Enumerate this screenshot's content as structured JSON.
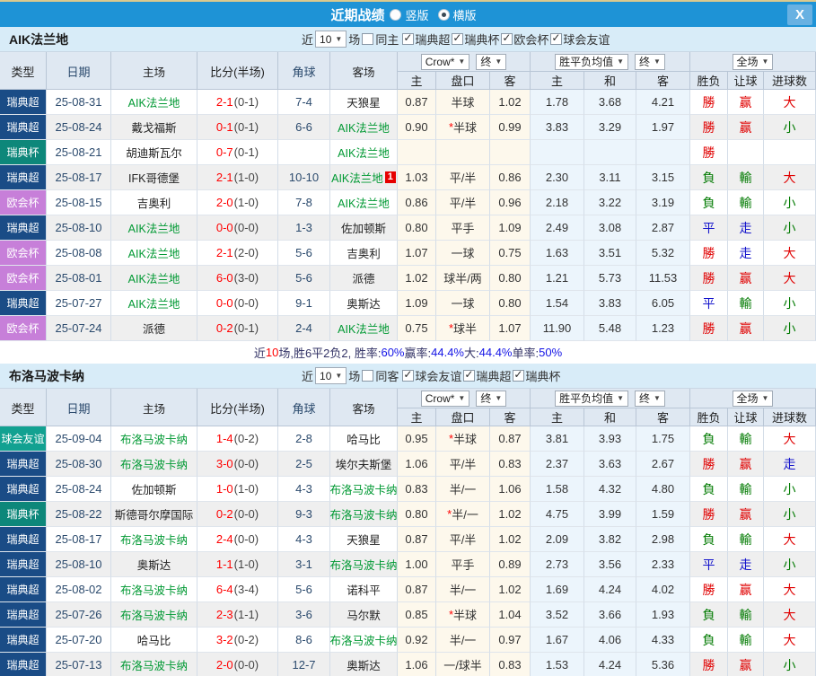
{
  "titlebar": {
    "title": "近期战绩",
    "radio_options": [
      {
        "label": "竖版",
        "selected": false
      },
      {
        "label": "横版",
        "selected": true
      }
    ],
    "close_label": "X"
  },
  "colors": {
    "topbar": "#1e93d6",
    "topbar_trim": "#dbc98e",
    "section_bg": "#d8ecf8",
    "header_bg": "#dfe8f2",
    "highlight_team": "#009933",
    "score_red": "#ff0000",
    "odds_cell_bg": "#fdf8ec",
    "avg_cell_bg": "#ecf5fc",
    "zebra_row_bg": "#efefef"
  },
  "league_colors": {
    "瑞典超": "#1a4c86",
    "瑞典杯": "#0d877a",
    "欧会杯": "#c77fd9",
    "球会友谊": "#12a191"
  },
  "result_colors": {
    "勝": "#e00000",
    "負": "#007a00",
    "平": "#1515cc",
    "赢": "#e00000",
    "輸": "#007a00",
    "走": "#1515cc",
    "大": "#e00000",
    "小": "#007a00"
  },
  "table_header": {
    "cols": [
      "类型",
      "日期",
      "主场",
      "比分(半场)",
      "角球",
      "客场"
    ],
    "odds_select": "Crow*",
    "odds_final_select": "终",
    "odds_subcols": [
      "主",
      "盘口",
      "客"
    ],
    "avg_select": "胜平负均值",
    "avg_final_select": "终",
    "avg_subcols": [
      "主",
      "和",
      "客"
    ],
    "scope_select": "全场",
    "result_subcols": [
      "胜负",
      "让球",
      "进球数"
    ]
  },
  "sections": [
    {
      "team": "AIK法兰地",
      "filter": {
        "prefix": "近",
        "count": "10",
        "suffix": "场",
        "same_option": {
          "label": "同主",
          "checked": false
        },
        "league_options": [
          {
            "label": "瑞典超",
            "checked": true
          },
          {
            "label": "瑞典杯",
            "checked": true
          },
          {
            "label": "欧会杯",
            "checked": true
          },
          {
            "label": "球会友谊",
            "checked": true
          }
        ]
      },
      "rows": [
        {
          "league": "瑞典超",
          "date": "25-08-31",
          "home": "AIK法兰地",
          "home_hl": true,
          "score": "2-1",
          "half": "(0-1)",
          "corners": "7-4",
          "away": "天狼星",
          "away_hl": false,
          "away_mark": "",
          "odds_home": "0.87",
          "line": "半球",
          "odds_away": "1.02",
          "avg_home": "1.78",
          "avg_draw": "3.68",
          "avg_away": "4.21",
          "result": "勝",
          "handicap_result": "赢",
          "goals_result": "大"
        },
        {
          "league": "瑞典超",
          "date": "25-08-24",
          "home": "戴戈福斯",
          "home_hl": false,
          "score": "0-1",
          "half": "(0-1)",
          "corners": "6-6",
          "away": "AIK法兰地",
          "away_hl": true,
          "away_mark": "",
          "odds_home": "0.90",
          "line": "*半球",
          "odds_away": "0.99",
          "avg_home": "3.83",
          "avg_draw": "3.29",
          "avg_away": "1.97",
          "result": "勝",
          "handicap_result": "赢",
          "goals_result": "小"
        },
        {
          "league": "瑞典杯",
          "date": "25-08-21",
          "home": "胡迪斯瓦尔",
          "home_hl": false,
          "score": "0-7",
          "half": "(0-1)",
          "corners": "",
          "away": "AIK法兰地",
          "away_hl": true,
          "away_mark": "",
          "odds_home": "",
          "line": "",
          "odds_away": "",
          "avg_home": "",
          "avg_draw": "",
          "avg_away": "",
          "result": "勝",
          "handicap_result": "",
          "goals_result": ""
        },
        {
          "league": "瑞典超",
          "date": "25-08-17",
          "home": "IFK哥德堡",
          "home_hl": false,
          "score": "2-1",
          "half": "(1-0)",
          "corners": "10-10",
          "away": "AIK法兰地",
          "away_hl": true,
          "away_mark": "1",
          "odds_home": "1.03",
          "line": "平/半",
          "odds_away": "0.86",
          "avg_home": "2.30",
          "avg_draw": "3.11",
          "avg_away": "3.15",
          "result": "負",
          "handicap_result": "輸",
          "goals_result": "大"
        },
        {
          "league": "欧会杯",
          "date": "25-08-15",
          "home": "吉奥利",
          "home_hl": false,
          "score": "2-0",
          "half": "(1-0)",
          "corners": "7-8",
          "away": "AIK法兰地",
          "away_hl": true,
          "away_mark": "",
          "odds_home": "0.86",
          "line": "平/半",
          "odds_away": "0.96",
          "avg_home": "2.18",
          "avg_draw": "3.22",
          "avg_away": "3.19",
          "result": "負",
          "handicap_result": "輸",
          "goals_result": "小"
        },
        {
          "league": "瑞典超",
          "date": "25-08-10",
          "home": "AIK法兰地",
          "home_hl": true,
          "score": "0-0",
          "half": "(0-0)",
          "corners": "1-3",
          "away": "佐加顿斯",
          "away_hl": false,
          "away_mark": "",
          "odds_home": "0.80",
          "line": "平手",
          "odds_away": "1.09",
          "avg_home": "2.49",
          "avg_draw": "3.08",
          "avg_away": "2.87",
          "result": "平",
          "handicap_result": "走",
          "goals_result": "小"
        },
        {
          "league": "欧会杯",
          "date": "25-08-08",
          "home": "AIK法兰地",
          "home_hl": true,
          "score": "2-1",
          "half": "(2-0)",
          "corners": "5-6",
          "away": "吉奥利",
          "away_hl": false,
          "away_mark": "",
          "odds_home": "1.07",
          "line": "一球",
          "odds_away": "0.75",
          "avg_home": "1.63",
          "avg_draw": "3.51",
          "avg_away": "5.32",
          "result": "勝",
          "handicap_result": "走",
          "goals_result": "大"
        },
        {
          "league": "欧会杯",
          "date": "25-08-01",
          "home": "AIK法兰地",
          "home_hl": true,
          "score": "6-0",
          "half": "(3-0)",
          "corners": "5-6",
          "away": "派德",
          "away_hl": false,
          "away_mark": "",
          "odds_home": "1.02",
          "line": "球半/两",
          "odds_away": "0.80",
          "avg_home": "1.21",
          "avg_draw": "5.73",
          "avg_away": "11.53",
          "result": "勝",
          "handicap_result": "赢",
          "goals_result": "大"
        },
        {
          "league": "瑞典超",
          "date": "25-07-27",
          "home": "AIK法兰地",
          "home_hl": true,
          "score": "0-0",
          "half": "(0-0)",
          "corners": "9-1",
          "away": "奥斯达",
          "away_hl": false,
          "away_mark": "",
          "odds_home": "1.09",
          "line": "一球",
          "odds_away": "0.80",
          "avg_home": "1.54",
          "avg_draw": "3.83",
          "avg_away": "6.05",
          "result": "平",
          "handicap_result": "輸",
          "goals_result": "小"
        },
        {
          "league": "欧会杯",
          "date": "25-07-24",
          "home": "派德",
          "home_hl": false,
          "score": "0-2",
          "half": "(0-1)",
          "corners": "2-4",
          "away": "AIK法兰地",
          "away_hl": true,
          "away_mark": "",
          "odds_home": "0.75",
          "line": "*球半",
          "odds_away": "1.07",
          "avg_home": "11.90",
          "avg_draw": "5.48",
          "avg_away": "1.23",
          "result": "勝",
          "handicap_result": "赢",
          "goals_result": "小"
        }
      ],
      "summary": [
        {
          "t": "近",
          "c": "dark"
        },
        {
          "t": "10",
          "c": "red"
        },
        {
          "t": "场,胜6平2负2, 胜率:",
          "c": "dark"
        },
        {
          "t": "60%",
          "c": "blue"
        },
        {
          "t": " 赢率:",
          "c": "dark"
        },
        {
          "t": "44.4%",
          "c": "blue"
        },
        {
          "t": " 大:",
          "c": "dark"
        },
        {
          "t": "44.4%",
          "c": "blue"
        },
        {
          "t": " 单率:",
          "c": "dark"
        },
        {
          "t": "50%",
          "c": "blue"
        }
      ]
    },
    {
      "team": "布洛马波卡纳",
      "filter": {
        "prefix": "近",
        "count": "10",
        "suffix": "场",
        "same_option": {
          "label": "同客",
          "checked": false
        },
        "league_options": [
          {
            "label": "球会友谊",
            "checked": true
          },
          {
            "label": "瑞典超",
            "checked": true
          },
          {
            "label": "瑞典杯",
            "checked": true
          }
        ]
      },
      "rows": [
        {
          "league": "球会友谊",
          "date": "25-09-04",
          "home": "布洛马波卡纳",
          "home_hl": true,
          "score": "1-4",
          "half": "(0-2)",
          "corners": "2-8",
          "away": "哈马比",
          "away_hl": false,
          "away_mark": "",
          "odds_home": "0.95",
          "line": "*半球",
          "odds_away": "0.87",
          "avg_home": "3.81",
          "avg_draw": "3.93",
          "avg_away": "1.75",
          "result": "負",
          "handicap_result": "輸",
          "goals_result": "大"
        },
        {
          "league": "瑞典超",
          "date": "25-08-30",
          "home": "布洛马波卡纳",
          "home_hl": true,
          "score": "3-0",
          "half": "(0-0)",
          "corners": "2-5",
          "away": "埃尔夫斯堡",
          "away_hl": false,
          "away_mark": "",
          "odds_home": "1.06",
          "line": "平/半",
          "odds_away": "0.83",
          "avg_home": "2.37",
          "avg_draw": "3.63",
          "avg_away": "2.67",
          "result": "勝",
          "handicap_result": "赢",
          "goals_result": "走"
        },
        {
          "league": "瑞典超",
          "date": "25-08-24",
          "home": "佐加顿斯",
          "home_hl": false,
          "score": "1-0",
          "half": "(1-0)",
          "corners": "4-3",
          "away": "布洛马波卡纳",
          "away_hl": true,
          "away_mark": "",
          "odds_home": "0.83",
          "line": "半/一",
          "odds_away": "1.06",
          "avg_home": "1.58",
          "avg_draw": "4.32",
          "avg_away": "4.80",
          "result": "負",
          "handicap_result": "輸",
          "goals_result": "小"
        },
        {
          "league": "瑞典杯",
          "date": "25-08-22",
          "home": "斯德哥尔摩国际",
          "home_hl": false,
          "score": "0-2",
          "half": "(0-0)",
          "corners": "9-3",
          "away": "布洛马波卡纳",
          "away_hl": true,
          "away_mark": "",
          "odds_home": "0.80",
          "line": "*半/一",
          "odds_away": "1.02",
          "avg_home": "4.75",
          "avg_draw": "3.99",
          "avg_away": "1.59",
          "result": "勝",
          "handicap_result": "赢",
          "goals_result": "小"
        },
        {
          "league": "瑞典超",
          "date": "25-08-17",
          "home": "布洛马波卡纳",
          "home_hl": true,
          "score": "2-4",
          "half": "(0-0)",
          "corners": "4-3",
          "away": "天狼星",
          "away_hl": false,
          "away_mark": "",
          "odds_home": "0.87",
          "line": "平/半",
          "odds_away": "1.02",
          "avg_home": "2.09",
          "avg_draw": "3.82",
          "avg_away": "2.98",
          "result": "負",
          "handicap_result": "輸",
          "goals_result": "大"
        },
        {
          "league": "瑞典超",
          "date": "25-08-10",
          "home": "奥斯达",
          "home_hl": false,
          "score": "1-1",
          "half": "(1-0)",
          "corners": "3-1",
          "away": "布洛马波卡纳",
          "away_hl": true,
          "away_mark": "",
          "odds_home": "1.00",
          "line": "平手",
          "odds_away": "0.89",
          "avg_home": "2.73",
          "avg_draw": "3.56",
          "avg_away": "2.33",
          "result": "平",
          "handicap_result": "走",
          "goals_result": "小"
        },
        {
          "league": "瑞典超",
          "date": "25-08-02",
          "home": "布洛马波卡纳",
          "home_hl": true,
          "score": "6-4",
          "half": "(3-4)",
          "corners": "5-6",
          "away": "诺科平",
          "away_hl": false,
          "away_mark": "",
          "odds_home": "0.87",
          "line": "半/一",
          "odds_away": "1.02",
          "avg_home": "1.69",
          "avg_draw": "4.24",
          "avg_away": "4.02",
          "result": "勝",
          "handicap_result": "赢",
          "goals_result": "大"
        },
        {
          "league": "瑞典超",
          "date": "25-07-26",
          "home": "布洛马波卡纳",
          "home_hl": true,
          "score": "2-3",
          "half": "(1-1)",
          "corners": "3-6",
          "away": "马尔默",
          "away_hl": false,
          "away_mark": "",
          "odds_home": "0.85",
          "line": "*半球",
          "odds_away": "1.04",
          "avg_home": "3.52",
          "avg_draw": "3.66",
          "avg_away": "1.93",
          "result": "負",
          "handicap_result": "輸",
          "goals_result": "大"
        },
        {
          "league": "瑞典超",
          "date": "25-07-20",
          "home": "哈马比",
          "home_hl": false,
          "score": "3-2",
          "half": "(0-2)",
          "corners": "8-6",
          "away": "布洛马波卡纳",
          "away_hl": true,
          "away_mark": "",
          "odds_home": "0.92",
          "line": "半/一",
          "odds_away": "0.97",
          "avg_home": "1.67",
          "avg_draw": "4.06",
          "avg_away": "4.33",
          "result": "負",
          "handicap_result": "輸",
          "goals_result": "大"
        },
        {
          "league": "瑞典超",
          "date": "25-07-13",
          "home": "布洛马波卡纳",
          "home_hl": true,
          "score": "2-0",
          "half": "(0-0)",
          "corners": "12-7",
          "away": "奥斯达",
          "away_hl": false,
          "away_mark": "",
          "odds_home": "1.06",
          "line": "一/球半",
          "odds_away": "0.83",
          "avg_home": "1.53",
          "avg_draw": "4.24",
          "avg_away": "5.36",
          "result": "勝",
          "handicap_result": "赢",
          "goals_result": "小"
        }
      ],
      "summary": []
    }
  ]
}
